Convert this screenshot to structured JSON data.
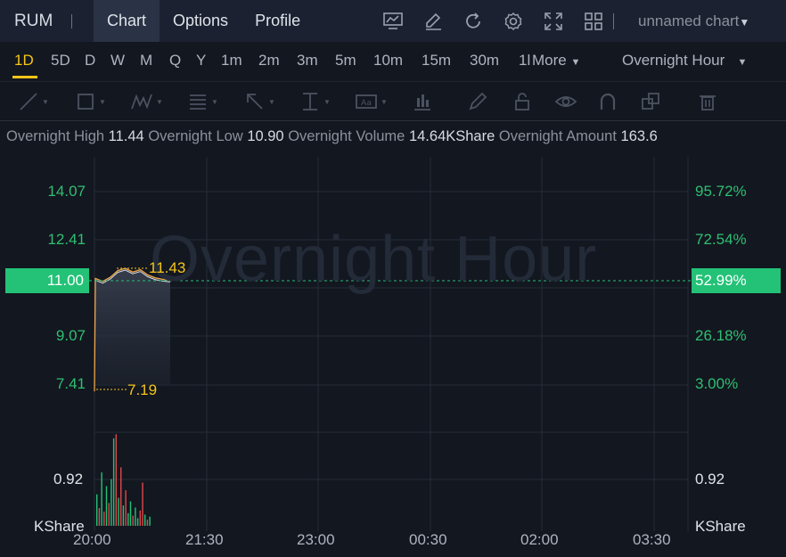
{
  "topbar": {
    "symbol": "RUM",
    "tabs": [
      "Chart",
      "Options",
      "Profile"
    ],
    "icons": [
      "indicator-icon",
      "draw-icon",
      "refresh-icon",
      "settings-icon",
      "fullscreen-icon",
      "layout-icon"
    ],
    "chart_name": "unnamed chart"
  },
  "intervals": {
    "items": [
      "1D",
      "5D",
      "D",
      "W",
      "M",
      "Q",
      "Y",
      "1m",
      "2m",
      "3m",
      "5m",
      "10m",
      "15m",
      "30m",
      "1l",
      "More"
    ],
    "active": "1D",
    "session": "Overnight Hour"
  },
  "toolbar": {
    "tools": [
      "trend-line-icon",
      "rectangle-icon",
      "pattern-icon",
      "fibonacci-icon",
      "arrow-icon",
      "measure-icon",
      "text-icon",
      "indicator-bars-icon",
      "brush-icon",
      "lock-icon",
      "eye-icon",
      "magnet-icon",
      "copy-icon",
      "trash-icon"
    ]
  },
  "info": {
    "overnight_high_label": "Overnight High",
    "overnight_high": "11.44",
    "overnight_low_label": "Overnight Low",
    "overnight_low": "10.90",
    "overnight_volume_label": "Overnight Volume",
    "overnight_volume": "14.64KShare",
    "overnight_amount_label": "Overnight Amount",
    "overnight_amount": "163.6"
  },
  "chart": {
    "watermark": "Overnight Hour",
    "left_axis": [
      "14.07",
      "12.41",
      "9.07",
      "7.41"
    ],
    "right_axis": [
      "95.72%",
      "72.54%",
      "26.18%",
      "3.00%"
    ],
    "current_price": "11.00",
    "current_pct": "52.99%",
    "high_marker": "11.43",
    "low_marker": "7.19",
    "volume_left": "0.92",
    "volume_right": "0.92",
    "volume_unit": "KShare",
    "time_axis": [
      "20:00",
      "21:30",
      "23:00",
      "00:30",
      "02:00",
      "03:30"
    ]
  },
  "colors": {
    "background": "#131720",
    "up": "#23c277",
    "down": "#e0474c",
    "accent": "#f5c518"
  },
  "chart_data": {
    "type": "line",
    "y_range": [
      5.75,
      15.73
    ],
    "price_series": [
      {
        "t": "20:00",
        "y": 7.19
      },
      {
        "t": "20:00",
        "y": 11.08
      },
      {
        "t": "20:06",
        "y": 10.98
      },
      {
        "t": "20:12",
        "y": 11.12
      },
      {
        "t": "20:18",
        "y": 11.35
      },
      {
        "t": "20:24",
        "y": 11.43
      },
      {
        "t": "20:30",
        "y": 11.3
      },
      {
        "t": "20:36",
        "y": 11.38
      },
      {
        "t": "20:42",
        "y": 11.2
      },
      {
        "t": "20:48",
        "y": 11.1
      },
      {
        "t": "20:54",
        "y": 11.05
      },
      {
        "t": "21:00",
        "y": 11.02
      }
    ],
    "current_price": 11.0,
    "high": 11.43,
    "low": 7.19,
    "volume_ylim": [
      0,
      1.84
    ],
    "volume": [
      {
        "v": 0.62,
        "up": true
      },
      {
        "v": 0.35,
        "up": false
      },
      {
        "v": 1.05,
        "up": true
      },
      {
        "v": 0.28,
        "up": false
      },
      {
        "v": 0.78,
        "up": true
      },
      {
        "v": 0.45,
        "up": false
      },
      {
        "v": 0.92,
        "up": true
      },
      {
        "v": 1.72,
        "up": true
      },
      {
        "v": 1.8,
        "up": false
      },
      {
        "v": 0.55,
        "up": true
      },
      {
        "v": 1.15,
        "up": false
      },
      {
        "v": 0.4,
        "up": true
      },
      {
        "v": 0.7,
        "up": false
      },
      {
        "v": 0.25,
        "up": true
      },
      {
        "v": 0.48,
        "up": true
      },
      {
        "v": 0.2,
        "up": false
      },
      {
        "v": 0.36,
        "up": true
      },
      {
        "v": 0.15,
        "up": true
      },
      {
        "v": 0.3,
        "up": false
      },
      {
        "v": 0.85,
        "up": false
      },
      {
        "v": 0.22,
        "up": true
      },
      {
        "v": 0.12,
        "up": false
      },
      {
        "v": 0.18,
        "up": true
      }
    ]
  }
}
